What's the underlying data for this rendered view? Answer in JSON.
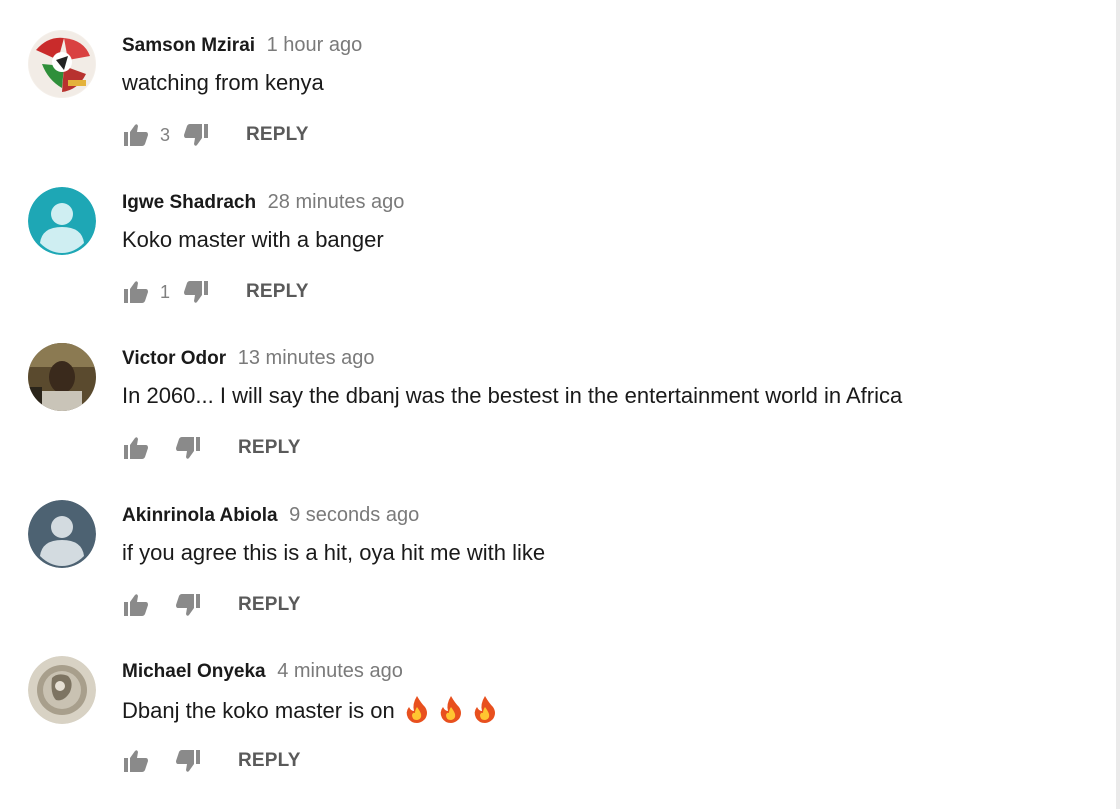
{
  "comments": [
    {
      "author": "Samson Mzirai",
      "time": "1 hour ago",
      "text": "watching from kenya",
      "like_count": "3",
      "reply_label": "REPLY",
      "avatar": "photo-avatar"
    },
    {
      "author": "Igwe Shadrach",
      "time": "28 minutes ago",
      "text": "Koko master with a banger",
      "like_count": "1",
      "reply_label": "REPLY",
      "avatar": "default-avatar-teal"
    },
    {
      "author": "Victor Odor",
      "time": "13 minutes ago",
      "text": "In 2060... I will say the dbanj was the bestest in the entertainment world in Africa",
      "like_count": "",
      "reply_label": "REPLY",
      "avatar": "photo-avatar"
    },
    {
      "author": "Akinrinola Abiola",
      "time": "9 seconds ago",
      "text": "if you agree this is a hit, oya hit me with like",
      "like_count": "",
      "reply_label": "REPLY",
      "avatar": "default-avatar-slate"
    },
    {
      "author": "Michael Onyeka",
      "time": "4 minutes ago",
      "text": "Dbanj the koko master is on",
      "like_count": "",
      "reply_label": "REPLY",
      "avatar": "photo-avatar",
      "trailing_icons": [
        "fire-emoji",
        "fire-emoji",
        "fire-emoji"
      ]
    }
  ],
  "colors": {
    "author": "#1a1a1a",
    "time": "#7a7a7a",
    "icon": "#8a8a8a",
    "reply": "#5a5a5a",
    "avatar_teal": "#1ea7b5",
    "avatar_slate": "#4d6272"
  }
}
